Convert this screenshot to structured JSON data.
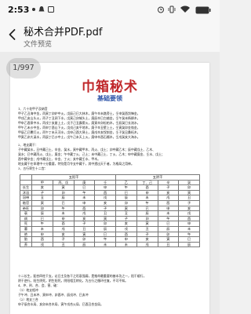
{
  "status_bar": {
    "time": "2:53",
    "icons": [
      "dot-icon",
      "notification-icon",
      "alarm-icon",
      "vibrate-icon",
      "wifi-icon",
      "battery-icon"
    ]
  },
  "header": {
    "title": "秘术合并PDF.pdf",
    "subtitle": "文件预览",
    "back_icon": "arrow-left-icon"
  },
  "viewer": {
    "page_indicator": "1/997"
  },
  "document": {
    "title": "巾箱秘术",
    "subtitle": "基础要领",
    "section1": [
      "1、六十花甲子及纳音",
      "甲子乙丑海中金，丙寅丁卯炉中火，戊辰己巳大林木，庚午辛未路旁土，壬申癸酉剑锋金，",
      "甲戌乙亥山头火，丙子丁丑涧下水，戊寅己卯城头土，庚辰辛巳白蜡金，壬午癸未杨柳木，",
      "甲申乙酉泉中水，丙戌丁亥屋上土，戊子己丑霹雳火，庚寅辛卯松柏木，壬辰癸巳长流水，",
      "甲午乙未沙中金，丙申丁酉山下火，戊戌己亥平地木，庚子辛丑壁上土，壬寅癸卯金箔金，",
      "甲辰乙巳覆灯火，丙午丁未天河水，戊申己酉大驿土，庚戌辛亥钗钏金，壬子癸丑桑柘木，",
      "甲寅乙卯大溪水，丙辰丁巳沙中土，戊午己未天上火，庚申辛酉石榴木，壬戌癸亥大海水。"
    ],
    "section2": [
      "2、地支藏干：",
      "子中藏癸水，丑中藏己土、辛金、癸水，寅中藏甲木、丙火、戊土；卯中藏乙木；辰中藏戊土、乙木、",
      "癸水；巳中藏丙火、戊土、庚金；午中藏丁火、己土；未中藏己土、丁火、乙木；申中藏庚金、壬水、戊土；",
      "酉中藏辛金；戌中藏戊土、辛金、丁火；亥中藏壬水、甲木。",
      "地支藏干在命理中十分重要，特别是月令支中藏干，其中透出天干者，为格局之用神。",
      "3、五行寄生十二宫："
    ],
    "table": {
      "header1": [
        "",
        "五阳干",
        "五阴干"
      ],
      "header2": [
        "",
        "甲",
        "丙、戊",
        "庚",
        "壬",
        "乙",
        "丁、己",
        "辛",
        "癸"
      ],
      "rows": [
        [
          "长生",
          "亥",
          "寅",
          "巳",
          "申",
          "午",
          "酉",
          "子",
          "卯"
        ],
        [
          "沐浴",
          "子",
          "卯",
          "午",
          "酉",
          "巳",
          "申",
          "亥",
          "寅"
        ],
        [
          "冠带",
          "丑",
          "辰",
          "未",
          "戌",
          "辰",
          "未",
          "戌",
          "丑"
        ],
        [
          "临官",
          "寅",
          "巳",
          "申",
          "亥",
          "卯",
          "午",
          "酉",
          "子"
        ],
        [
          "帝旺",
          "卯",
          "午",
          "酉",
          "子",
          "寅",
          "巳",
          "申",
          "亥"
        ],
        [
          "衰",
          "辰",
          "未",
          "戌",
          "丑",
          "丑",
          "辰",
          "未",
          "戌"
        ],
        [
          "病",
          "巳",
          "申",
          "亥",
          "寅",
          "子",
          "卯",
          "午",
          "酉"
        ],
        [
          "死",
          "午",
          "酉",
          "子",
          "卯",
          "亥",
          "寅",
          "巳",
          "申"
        ],
        [
          "墓",
          "未",
          "戌",
          "丑",
          "辰",
          "戌",
          "丑",
          "辰",
          "未"
        ],
        [
          "绝",
          "申",
          "亥",
          "寅",
          "巳",
          "酉",
          "子",
          "卯",
          "午"
        ],
        [
          "胎",
          "酉",
          "子",
          "卯",
          "午",
          "申",
          "亥",
          "寅",
          "巳"
        ],
        [
          "养",
          "戌",
          "丑",
          "辰",
          "未",
          "未",
          "戌",
          "丑",
          "辰"
        ]
      ]
    },
    "section3": [
      "十二长生，配合四柱干支，论日主及各干之旺衰强弱，是推命最重要的基本功之一，阳干顺行，",
      "阴干逆行。阳生阴死，阴生阳死，阴阳相互转化，为五行之循环往复，不可不知。",
      "4、冲、刑、合、会、害、破：",
      "（1）地支相冲",
      "子午冲、丑未冲、寅申冲、卯酉冲、辰戌冲、巳亥冲",
      "（2）地支三合",
      "申子辰合水局、亥卯未合木局、寅午戌合火局、巳酉丑合金局。"
    ]
  }
}
